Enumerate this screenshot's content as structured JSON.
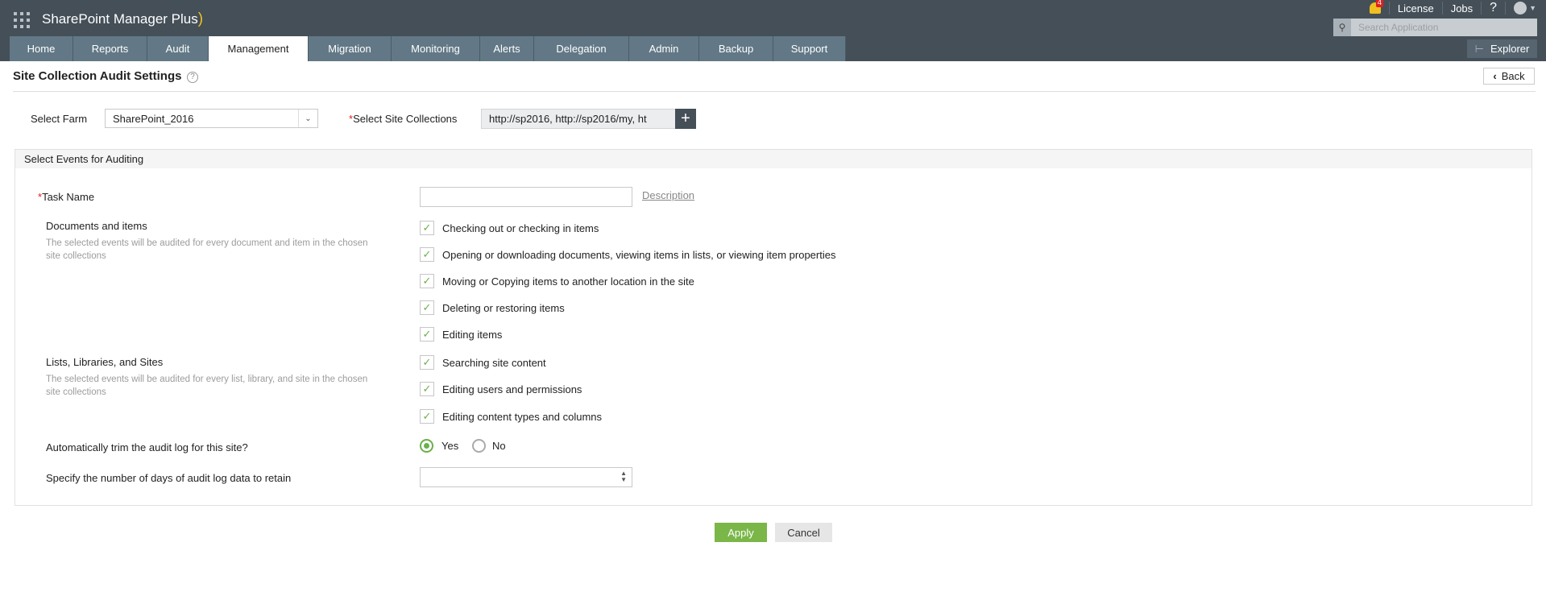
{
  "app": {
    "title": "SharePoint Manager Plus",
    "notification_count": "4",
    "links": [
      "License",
      "Jobs",
      "?"
    ],
    "search_placeholder": "Search Application",
    "explorer_label": "Explorer"
  },
  "tabs": [
    "Home",
    "Reports",
    "Audit",
    "Management",
    "Migration",
    "Monitoring",
    "Alerts",
    "Delegation",
    "Admin",
    "Backup",
    "Support"
  ],
  "active_tab": "Management",
  "page": {
    "title": "Site Collection Audit Settings",
    "help": "?",
    "back_label": "Back"
  },
  "farm": {
    "label": "Select Farm",
    "value": "SharePoint_2016"
  },
  "sites": {
    "required": "*",
    "label": "Select Site Collections",
    "value": "http://sp2016, http://sp2016/my, ht",
    "add": "+"
  },
  "section": {
    "title": "Select Events for Auditing",
    "task_name": {
      "required": "*",
      "label": "Task Name",
      "value": "",
      "description_link": "Description"
    },
    "groups": [
      {
        "label": "Documents and items",
        "description": "The selected events will be audited for every document and item in the chosen site collections",
        "events": [
          {
            "label": "Checking out or checking in items",
            "checked": true
          },
          {
            "label": "Opening or downloading documents, viewing items in lists, or viewing item properties",
            "checked": true
          },
          {
            "label": "Moving or Copying items to another location in the site",
            "checked": true
          },
          {
            "label": "Deleting or restoring items",
            "checked": true
          },
          {
            "label": "Editing items",
            "checked": true
          }
        ]
      },
      {
        "label": "Lists, Libraries, and Sites",
        "description": "The selected events will be audited for every list, library, and site in the chosen site collections",
        "events": [
          {
            "label": "Searching site content",
            "checked": true
          },
          {
            "label": "Editing users and permissions",
            "checked": true
          },
          {
            "label": "Editing content types and columns",
            "checked": true
          }
        ]
      }
    ],
    "trim": {
      "label": "Automatically trim the audit log for this site?",
      "yes": "Yes",
      "no": "No",
      "selected": "Yes"
    },
    "retain": {
      "label": "Specify the number of days of audit log data to retain",
      "value": ""
    }
  },
  "actions": {
    "apply": "Apply",
    "cancel": "Cancel"
  },
  "colors": {
    "header": "#444f58",
    "tab": "#627886",
    "accent": "#7ab648"
  }
}
